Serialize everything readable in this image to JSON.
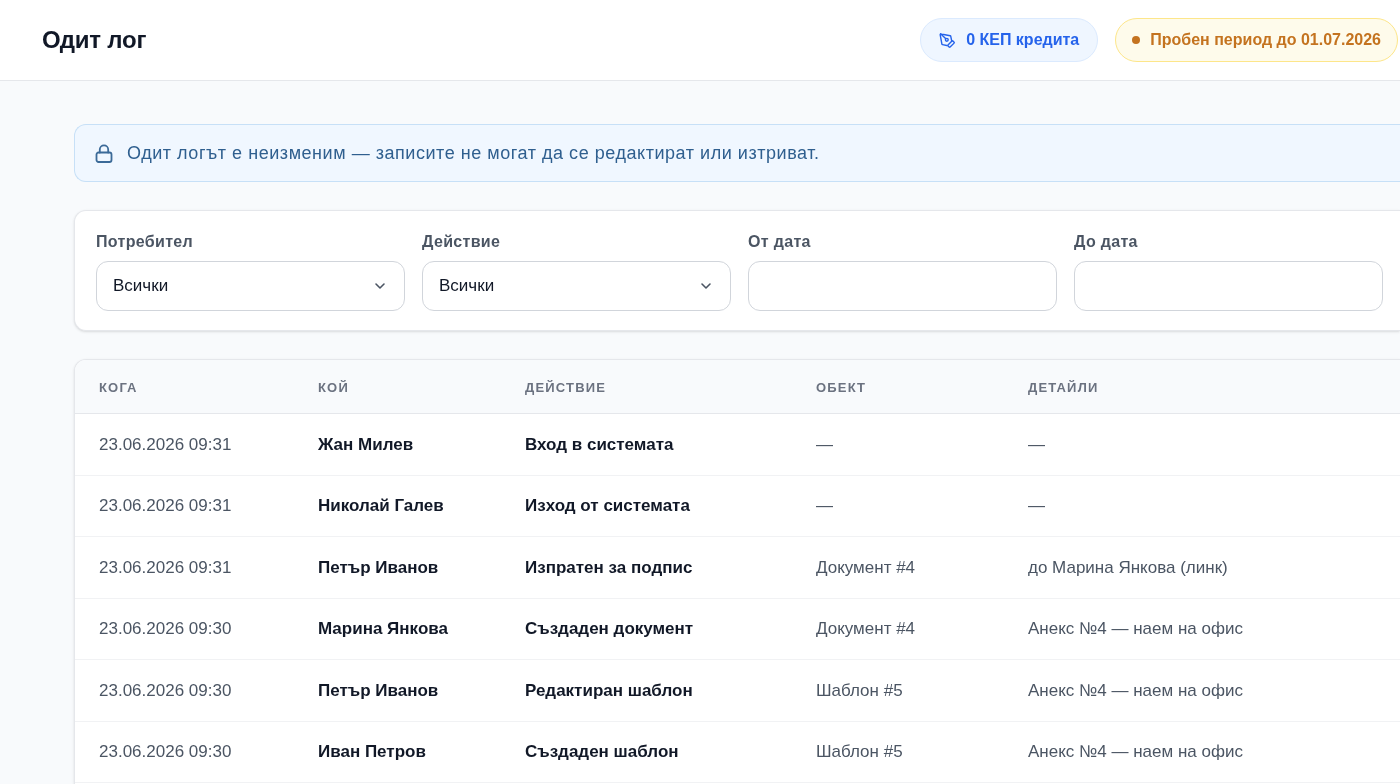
{
  "header": {
    "title": "Одит лог",
    "credits_badge": "0 КЕП кредита",
    "trial_badge": "Пробен период до 01.07.2026"
  },
  "notice": {
    "text": "Одит логът е неизменим — записите не могат да се редактират или изтриват."
  },
  "filters": [
    {
      "kind": "select",
      "label": "Потребител",
      "value": "Всички"
    },
    {
      "kind": "select",
      "label": "Действие",
      "value": "Всички"
    },
    {
      "kind": "date",
      "label": "От дата"
    },
    {
      "kind": "date",
      "label": "До дата"
    }
  ],
  "table": {
    "columns": [
      "КОГА",
      "КОЙ",
      "ДЕЙСТВИЕ",
      "ОБЕКТ",
      "ДЕТАЙЛИ"
    ],
    "rows": [
      {
        "when": "23.06.2026 09:31",
        "who": "Жан Милев",
        "action": "Вход в системата",
        "object": "—",
        "details": "—"
      },
      {
        "when": "23.06.2026 09:31",
        "who": "Николай Галев",
        "action": "Изход от системата",
        "object": "—",
        "details": "—"
      },
      {
        "when": "23.06.2026 09:31",
        "who": "Петър Иванов",
        "action": "Изпратен за подпис",
        "object": "Документ #4",
        "details": "до Марина Янкова (линк)"
      },
      {
        "when": "23.06.2026 09:30",
        "who": "Марина Янкова",
        "action": "Създаден документ",
        "object": "Документ #4",
        "details": "Анекс №4 — наем на офис"
      },
      {
        "when": "23.06.2026 09:30",
        "who": "Петър Иванов",
        "action": "Редактиран шаблон",
        "object": "Шаблон #5",
        "details": "Анекс №4 — наем на офис"
      },
      {
        "when": "23.06.2026 09:30",
        "who": "Иван Петров",
        "action": "Създаден шаблон",
        "object": "Шаблон #5",
        "details": "Анекс №4 — наем на офис"
      }
    ]
  }
}
